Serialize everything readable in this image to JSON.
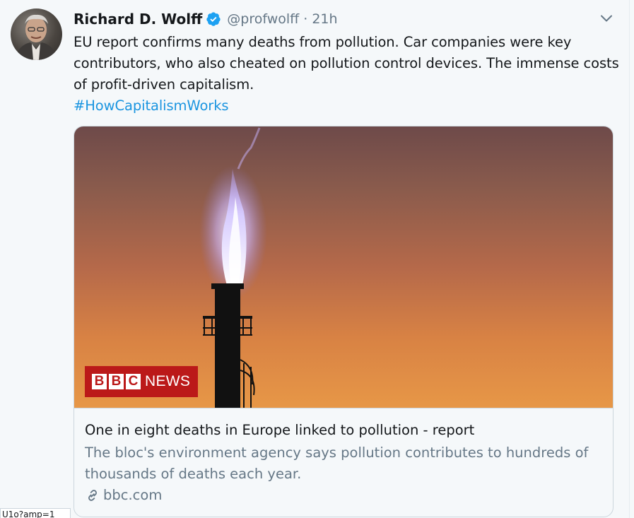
{
  "tweet": {
    "author_name": "Richard D. Wolff",
    "handle": "@profwolff",
    "separator": "·",
    "time": "21h",
    "text": "EU report confirms many deaths from pollution. Car companies were key contributors, who also cheated on pollution control devices. The immense costs of profit-driven capitalism.",
    "hashtag": "#HowCapitalismWorks"
  },
  "card": {
    "logo_letters": [
      "B",
      "B",
      "C"
    ],
    "logo_news": "NEWS",
    "title": "One in eight deaths in Europe linked to pollution - report",
    "description": "The bloc's environment agency says pollution contributes to hundreds of thousands of deaths each year.",
    "domain": "bbc.com"
  },
  "status_url_fragment": "U1o?amp=1",
  "icons": {
    "verified": "verified-badge-icon",
    "caret": "chevron-down-icon",
    "link": "link-icon"
  },
  "colors": {
    "accent": "#1b95e0",
    "verified": "#1da1f2",
    "secondary_text": "#657786",
    "bbc_red": "#bb1919"
  }
}
